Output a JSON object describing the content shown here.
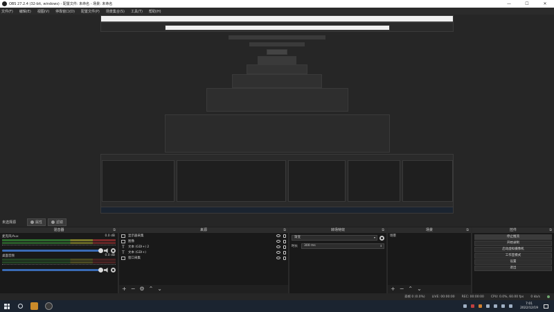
{
  "window": {
    "title": "OBS 27.2.4 (32-bit, windows) - 配置文件: 未命名 - 场景: 未命名",
    "minimize": "—",
    "maximize": "☐",
    "close": "✕"
  },
  "menu": [
    "文件(F)",
    "编辑(E)",
    "视图(V)",
    "停靠窗口(D)",
    "配置文件(P)",
    "场景集合(S)",
    "工具(T)",
    "帮助(H)"
  ],
  "scene_bar": {
    "label": "未选择源",
    "properties": "属性",
    "filters": "滤镜"
  },
  "docks": {
    "mixer": {
      "title": "混音器",
      "tracks": [
        {
          "name": "麦克风/Aux",
          "db": "0.0 dB"
        },
        {
          "name": "桌面音频",
          "db": "0.0 dB"
        }
      ]
    },
    "sources": {
      "title": "来源",
      "items": [
        {
          "label": "显示器采集",
          "icon": "monitor-icon"
        },
        {
          "label": "图像",
          "icon": "image-icon"
        },
        {
          "label": "文本 (GDI+) 2",
          "icon": "text-icon"
        },
        {
          "label": "文本 (GDI+)",
          "icon": "text-icon"
        },
        {
          "label": "窗口采集",
          "icon": "window-icon"
        }
      ]
    },
    "transitions": {
      "title": "转场特效",
      "type": "渐变",
      "duration_label": "时长",
      "duration": "300 ms"
    },
    "scenes": {
      "title": "场景",
      "items": [
        "场景"
      ]
    },
    "controls": {
      "title": "控件",
      "buttons": [
        "停止推流",
        "开始录制",
        "启动虚拟摄像机",
        "工作室模式",
        "设置",
        "退出"
      ]
    }
  },
  "status": {
    "dropped": "丢帧 0 (0.0%)",
    "live": "LIVE: 00:00:00",
    "rec": "REC: 00:00:00",
    "cpu": "CPU: 0.0%, 60.00 fps",
    "kbps": "0 kb/s"
  },
  "taskbar": {
    "time": "7:01",
    "date": "2022/12/19"
  }
}
